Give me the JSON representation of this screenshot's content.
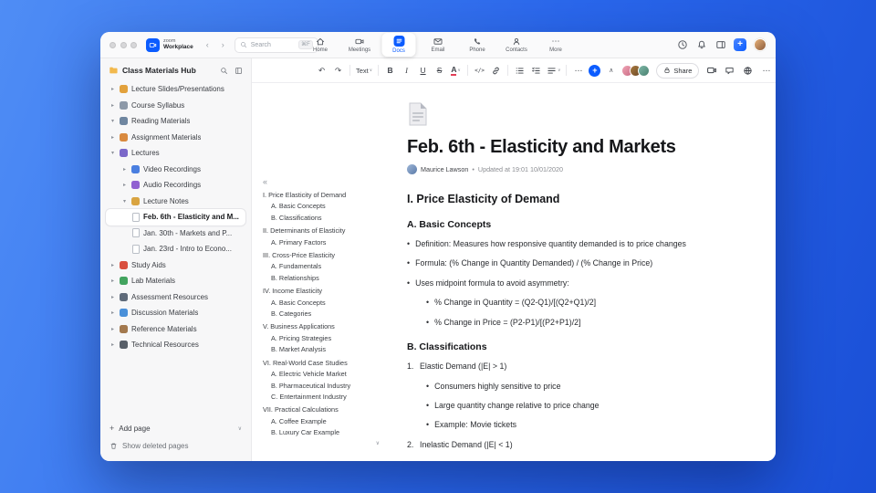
{
  "chrome": {
    "brand_top": "zoom",
    "brand_bottom": "Workplace",
    "search_placeholder": "Search",
    "search_shortcut": "⌘F",
    "tabs": [
      {
        "label": "Home",
        "icon": "home-icon",
        "active": false
      },
      {
        "label": "Meetings",
        "icon": "meetings-icon",
        "active": false
      },
      {
        "label": "Docs",
        "icon": "docs-icon",
        "active": true
      },
      {
        "label": "Email",
        "icon": "email-icon",
        "active": false
      },
      {
        "label": "Phone",
        "icon": "phone-icon",
        "active": false
      },
      {
        "label": "Contacts",
        "icon": "contacts-icon",
        "active": false
      },
      {
        "label": "More",
        "icon": "more-icon",
        "active": false
      }
    ]
  },
  "sidebar": {
    "title": "Class Materials Hub",
    "items": [
      {
        "label": "Lecture Slides/Presentations",
        "chev": "▸",
        "color": "#e2a13c",
        "depth": 0
      },
      {
        "label": "Course Syllabus",
        "chev": "▸",
        "color": "#8d99a8",
        "depth": 0
      },
      {
        "label": "Reading Materials",
        "chev": "▾",
        "color": "#6f86a0",
        "depth": 0
      },
      {
        "label": "Assignment Materials",
        "chev": "▸",
        "color": "#d98a3f",
        "depth": 0
      },
      {
        "label": "Lectures",
        "chev": "▾",
        "color": "#7b68c9",
        "depth": 0
      },
      {
        "label": "Video Recordings",
        "chev": "▸",
        "color": "#4a7fe0",
        "depth": 1
      },
      {
        "label": "Audio Recordings",
        "chev": "▸",
        "color": "#9061d1",
        "depth": 1
      },
      {
        "label": "Lecture Notes",
        "chev": "▾",
        "color": "#d9a441",
        "depth": 1
      },
      {
        "label": "Feb. 6th - Elasticity and M...",
        "chev": "",
        "color": "",
        "depth": 2,
        "selected": true
      },
      {
        "label": "Jan. 30th - Markets and P...",
        "chev": "",
        "color": "",
        "depth": 2,
        "selected": false
      },
      {
        "label": "Jan. 23rd - Intro to Econo...",
        "chev": "",
        "color": "",
        "depth": 2,
        "selected": false
      },
      {
        "label": "Study Aids",
        "chev": "▸",
        "color": "#d94f3f",
        "depth": 0
      },
      {
        "label": "Lab Materials",
        "chev": "▸",
        "color": "#43a45f",
        "depth": 0
      },
      {
        "label": "Assessment Resources",
        "chev": "▸",
        "color": "#5f6b7a",
        "depth": 0
      },
      {
        "label": "Discussion Materials",
        "chev": "▸",
        "color": "#4a90d9",
        "depth": 0
      },
      {
        "label": "Reference Materials",
        "chev": "▸",
        "color": "#a3794e",
        "depth": 0
      },
      {
        "label": "Technical Resources",
        "chev": "▸",
        "color": "#596069",
        "depth": 0
      }
    ],
    "add_page": "Add page",
    "show_deleted": "Show deleted pages"
  },
  "toolbar": {
    "text_style": "Text",
    "share_label": "Share"
  },
  "outline": {
    "items": [
      {
        "text": "I. Price Elasticity of Demand",
        "level": 0
      },
      {
        "text": "A. Basic Concepts",
        "level": 1
      },
      {
        "text": "B. Classifications",
        "level": 1
      },
      {
        "text": "II. Determinants of Elasticity",
        "level": 0
      },
      {
        "text": "A. Primary Factors",
        "level": 1
      },
      {
        "text": "III. Cross-Price Elasticity",
        "level": 0
      },
      {
        "text": "A. Fundamentals",
        "level": 1
      },
      {
        "text": "B. Relationships",
        "level": 1
      },
      {
        "text": "IV. Income Elasticity",
        "level": 0
      },
      {
        "text": "A. Basic Concepts",
        "level": 1
      },
      {
        "text": "B. Categories",
        "level": 1
      },
      {
        "text": "V. Business Applications",
        "level": 0
      },
      {
        "text": "A. Pricing Strategies",
        "level": 1
      },
      {
        "text": "B. Market Analysis",
        "level": 1
      },
      {
        "text": "VI. Real-World Case Studies",
        "level": 0
      },
      {
        "text": "A. Electric Vehicle Market",
        "level": 1
      },
      {
        "text": "B. Pharmaceutical Industry",
        "level": 1
      },
      {
        "text": "C. Entertainment Industry",
        "level": 1
      },
      {
        "text": "VII. Practical Calculations",
        "level": 0
      },
      {
        "text": "A. Coffee Example",
        "level": 1
      },
      {
        "text": "B. Luxury Car Example",
        "level": 1
      }
    ]
  },
  "doc": {
    "title": "Feb. 6th - Elasticity and Markets",
    "author": "Maurice Lawson",
    "updated": "Updated at 19:01 10/01/2020",
    "section1": "I. Price Elasticity of Demand",
    "sub_a": "A. Basic Concepts",
    "bullets_a": [
      "Definition: Measures how responsive quantity demanded is to price changes",
      "Formula: (% Change in Quantity Demanded) / (% Change in Price)",
      "Uses midpoint formula to avoid asymmetry:"
    ],
    "midpoint_subs": [
      "% Change in Quantity = (Q2-Q1)/[(Q2+Q1)/2]",
      "% Change in Price = (P2-P1)/[(P2+P1)/2]"
    ],
    "sub_b": "B. Classifications",
    "list_b": [
      {
        "num": "1.",
        "text": "Elastic Demand (|E| > 1)"
      },
      {
        "num": "2.",
        "text": "Inelastic Demand (|E| < 1)"
      }
    ],
    "elastic_subs": [
      "Consumers highly sensitive to price",
      "Large quantity change relative to price change",
      "Example: Movie tickets"
    ]
  },
  "icons": {
    "chevron_left": "‹",
    "chevron_right": "›",
    "chevron_down": "∨",
    "chevron_up": "∧",
    "collapse_outline": "«",
    "undo": "↶",
    "redo": "↷",
    "bold": "B",
    "italic": "I",
    "underline": "U",
    "strikethrough": "S",
    "text_color": "A",
    "code": "</>",
    "more_dots": "⋯",
    "plus": "+",
    "dot": "•",
    "bullet": "•"
  }
}
